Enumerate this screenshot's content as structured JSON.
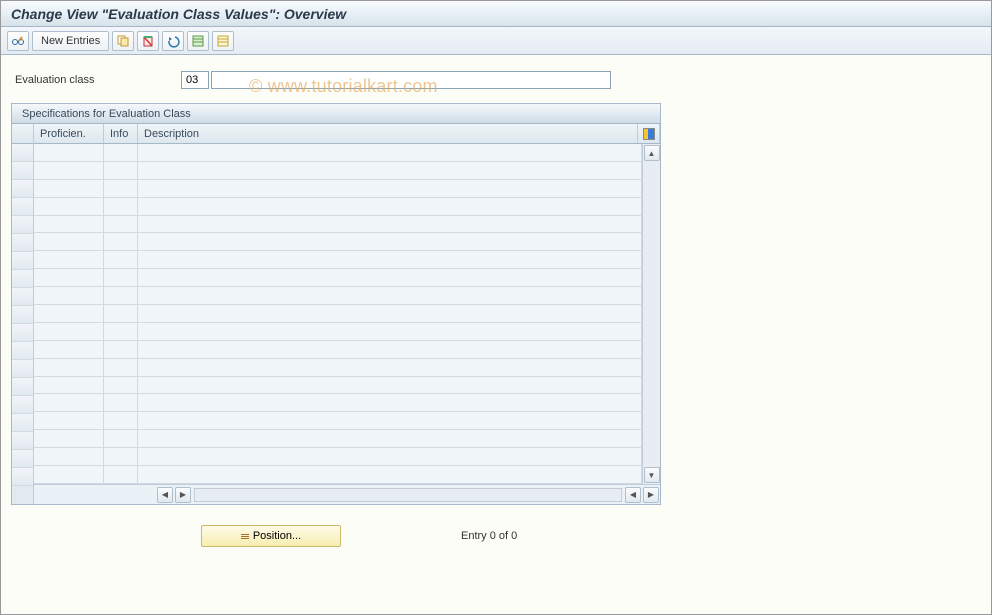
{
  "title": "Change View \"Evaluation Class Values\": Overview",
  "watermark": "© www.tutorialkart.com",
  "toolbar": {
    "new_entries_label": "New Entries"
  },
  "fields": {
    "evaluation_class_label": "Evaluation class",
    "evaluation_class_value": "03",
    "evaluation_class_text": ""
  },
  "panel": {
    "title": "Specifications for Evaluation Class",
    "columns": {
      "proficien": "Proficien.",
      "info": "Info",
      "description": "Description"
    },
    "rows": []
  },
  "footer": {
    "position_label": "Position...",
    "entry_status": "Entry 0 of 0"
  }
}
